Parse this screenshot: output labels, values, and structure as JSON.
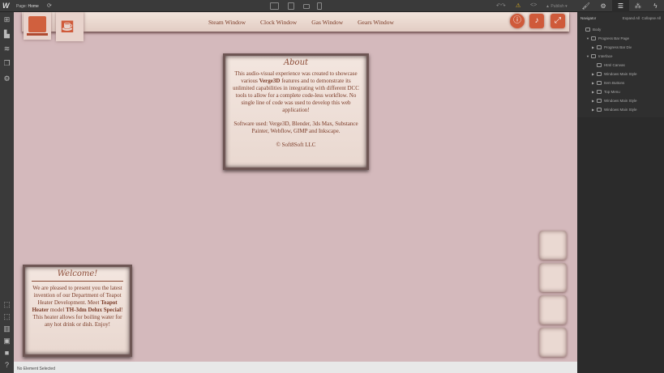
{
  "topbar": {
    "logo": "W",
    "page_label": "Page:",
    "page_name": "Home",
    "publish": "Publish"
  },
  "right_tabs": [
    "style-brush",
    "settings-gear",
    "navigator",
    "interactions",
    "lightning"
  ],
  "menu": {
    "links": [
      "Steam Window",
      "Clock Window",
      "Gas Window",
      "Gears Window"
    ]
  },
  "about": {
    "title": "About",
    "body": "This audio-visual experience was created to showcase various ",
    "bold": "Verge3D",
    "body2": " features and to demonstrate its unlimited capabilities in integrating with different DCC tools to allow for a complete code-less workflow. No single line of code was used to develop this web application!",
    "software": "Software used: Verge3D, Blender, 3ds Max, Substance Painter, Webflow, GIMP and Inkscape.",
    "copyright": "© Soft8Soft LLC"
  },
  "welcome": {
    "title": "Welcome!",
    "t1": "We are pleased to present you the latest invention of our Department of Teapot Heater Development. Meet ",
    "b1": "Teapot Heater",
    "t2": " model ",
    "b2": "TH-3dm Delux Special",
    "t3": "! This heater allows for boiling water for any hot drink or dish. Enjoy!"
  },
  "status": "No Element Selected",
  "navigator": {
    "title": "Navigator",
    "expand": "Expand All",
    "collapse": "Collapse All",
    "items": [
      {
        "label": "Body",
        "indent": 0,
        "arrow": ""
      },
      {
        "label": "Progress Bar Page",
        "indent": 1,
        "arrow": "▼"
      },
      {
        "label": "Progress Bar Div",
        "indent": 2,
        "arrow": "▶"
      },
      {
        "label": "Interface",
        "indent": 1,
        "arrow": "▼"
      },
      {
        "label": "Html Canvas",
        "indent": 2,
        "arrow": ""
      },
      {
        "label": "Windows Main Style",
        "indent": 2,
        "arrow": "▶"
      },
      {
        "label": "Item Buttons",
        "indent": 2,
        "arrow": "▶"
      },
      {
        "label": "Top Menu",
        "indent": 2,
        "arrow": "▶"
      },
      {
        "label": "Windows Main Style",
        "indent": 2,
        "arrow": "▶"
      },
      {
        "label": "Windows Main Style",
        "indent": 2,
        "arrow": "▶"
      }
    ]
  }
}
